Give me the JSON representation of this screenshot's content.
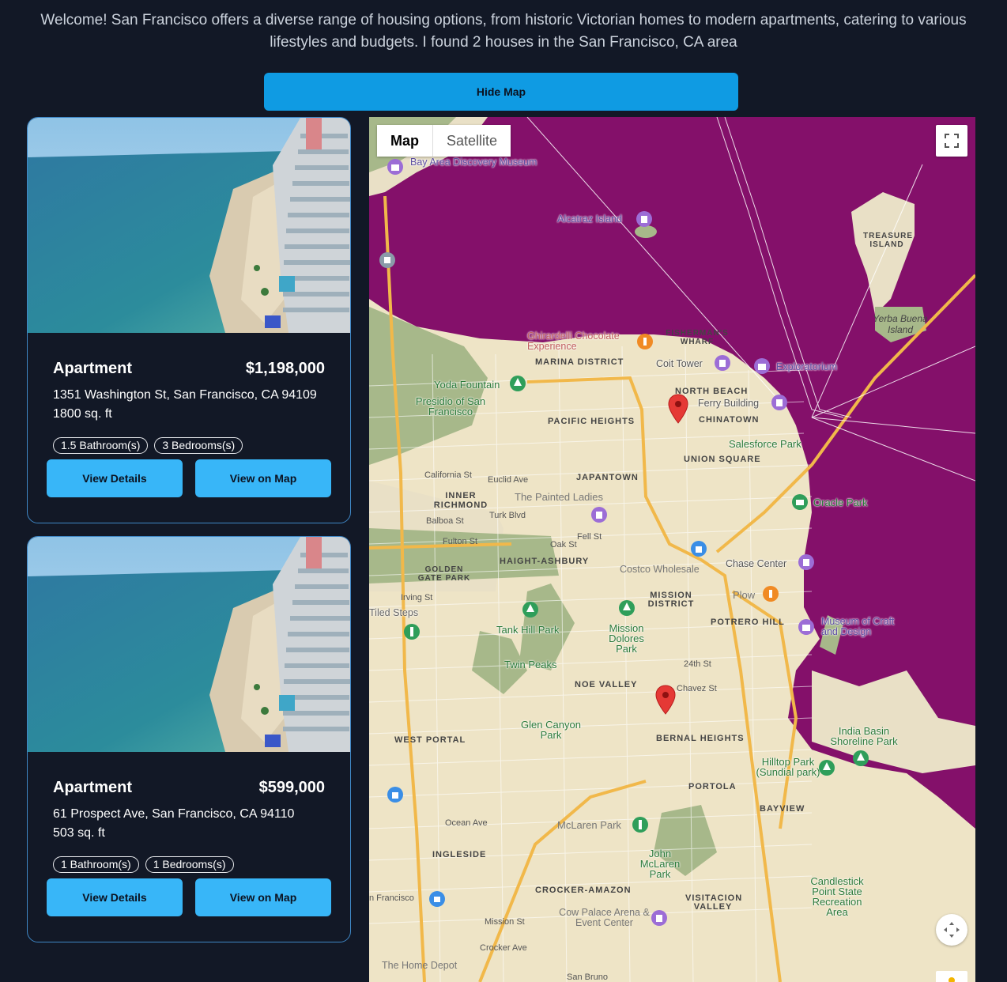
{
  "intro": "Welcome! San Francisco offers a diverse range of housing options, from historic Victorian homes to modern apartments, catering to various lifestyles and budgets. I found 2 houses in the San Francisco, CA area",
  "hide_map_label": "Hide Map",
  "listings": [
    {
      "type": "Apartment",
      "price": "$1,198,000",
      "address": "1351 Washington St, San Francisco, CA 94109",
      "sqft": "1800 sq. ft",
      "bathrooms": "1.5 Bathroom(s)",
      "bedrooms": "3 Bedrooms(s)",
      "view_details_label": "View Details",
      "view_on_map_label": "View on Map"
    },
    {
      "type": "Apartment",
      "price": "$599,000",
      "address": "61 Prospect Ave, San Francisco, CA 94110",
      "sqft": "503 sq. ft",
      "bathrooms": "1 Bathroom(s)",
      "bedrooms": "1 Bedrooms(s)",
      "view_details_label": "View Details",
      "view_on_map_label": "View on Map"
    }
  ],
  "map": {
    "type_map": "Map",
    "type_satellite": "Satellite",
    "labels": {
      "bay_area_discovery": "Bay Area Discovery Museum",
      "alcatraz": "Alcatraz Island",
      "treasure_island": "TREASURE ISLAND",
      "yerba_buena": "Yerba Buena Island",
      "ghirardelli": "Ghirardelli Chocolate Experience",
      "fishermans_wharf": "FISHERMAN'S WHARF",
      "marina": "MARINA DISTRICT",
      "coit": "Coit Tower",
      "exploratorium": "Exploratorium",
      "north_beach": "NORTH BEACH",
      "ferry": "Ferry Building",
      "chinatown": "CHINATOWN",
      "yoda": "Yoda Fountain",
      "presidio": "Presidio of San Francisco",
      "pacific_heights": "PACIFIC HEIGHTS",
      "salesforce": "Salesforce Park",
      "union_square": "UNION SQUARE",
      "japantown": "JAPANTOWN",
      "california_st": "California St",
      "euclid": "Euclid Ave",
      "painted_ladies": "The Painted Ladies",
      "oracle": "Oracle Park",
      "inner_richmond": "INNER RICHMOND",
      "balboa": "Balboa St",
      "turk": "Turk Blvd",
      "fulton": "Fulton St",
      "oak": "Oak St",
      "fell": "Fell St",
      "golden_gate_park": "GOLDEN GATE PARK",
      "haight": "HAIGHT-ASHBURY",
      "costco": "Costco Wholesale",
      "chase": "Chase Center",
      "irving": "Irving St",
      "mission_district": "MISSION DISTRICT",
      "plow": "Plow",
      "tiled_steps": "Tiled Steps",
      "tank_hill": "Tank Hill Park",
      "mission_dolores": "Mission Dolores Park",
      "potrero": "POTRERO HILL",
      "museum_craft": "Museum of Craft and Design",
      "twin_peaks": "Twin Peaks",
      "noe_valley": "NOE VALLEY",
      "st_24": "24th St",
      "chavez": "Chavez St",
      "glen_canyon": "Glen Canyon Park",
      "west_portal": "WEST PORTAL",
      "bernal": "BERNAL HEIGHTS",
      "india_basin": "India Basin Shoreline Park",
      "hilltop": "Hilltop Park (Sundial park)",
      "portola": "PORTOLA",
      "bayview": "BAYVIEW",
      "ocean_ave": "Ocean Ave",
      "mclaren": "McLaren Park",
      "john_mclaren": "John McLaren Park",
      "ingleside": "INGLESIDE",
      "crocker": "CROCKER-AMAZON",
      "visitacion": "VISITACION VALLEY",
      "candlestick": "Candlestick Point State Recreation Area",
      "cow_palace": "Cow Palace Arena & Event Center",
      "mission_st": "Mission St",
      "home_depot": "The Home Depot",
      "crocker_ave": "Crocker Ave",
      "san_bruno": "San Bruno",
      "francisco": "n Francisco"
    }
  }
}
